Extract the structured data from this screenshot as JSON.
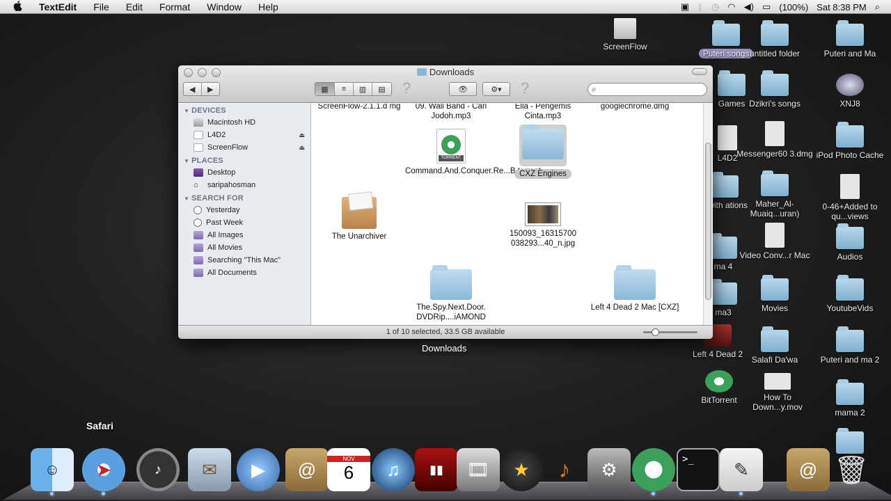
{
  "menubar": {
    "apple": "",
    "app": "TextEdit",
    "items": [
      "File",
      "Edit",
      "Format",
      "Window",
      "Help"
    ],
    "battery": "(100%)",
    "clock": "Sat 8:38 PM"
  },
  "desktop": {
    "icons": [
      {
        "label": "ScreenFlow"
      },
      {
        "label": "Puteri songs"
      },
      {
        "label": "untitled folder"
      },
      {
        "label": "Puteri and Ma"
      },
      {
        "label": "Games"
      },
      {
        "label": "Dzikri's songs"
      },
      {
        "label": "XNJ8"
      },
      {
        "label": "L4D2"
      },
      {
        "label": "Messenger60 3.dmg"
      },
      {
        "label": "iPod Photo Cache"
      },
      {
        "label": "s with ations"
      },
      {
        "label": "Maher_Al-Muaiq...uran)"
      },
      {
        "label": "0-46+Added to qu...views"
      },
      {
        "label": "ma 4"
      },
      {
        "label": "Video Conv...r Mac"
      },
      {
        "label": "Audios"
      },
      {
        "label": "ma3"
      },
      {
        "label": "Movies"
      },
      {
        "label": "YoutubeVids"
      },
      {
        "label": "Left 4 Dead 2"
      },
      {
        "label": "Salafi Da'wa"
      },
      {
        "label": "Puteri and ma 2"
      },
      {
        "label": "BitTorrent"
      },
      {
        "label": "How To Down...y.mov"
      },
      {
        "label": "mama 2"
      }
    ]
  },
  "window": {
    "title": "Downloads",
    "search_placeholder": "",
    "status": "1 of 10 selected, 33.5 GB available",
    "toolbar": {
      "back": "◀",
      "forward": "▶",
      "view_icon": "▦",
      "view_list": "≡",
      "view_column": "▥",
      "view_coverflow": "▤",
      "quicklook": "👁",
      "action": "⚙▾",
      "help": "?"
    },
    "sidebar": {
      "devices_header": "DEVICES",
      "devices": [
        {
          "label": "Macintosh HD",
          "eject": false
        },
        {
          "label": "L4D2",
          "eject": true
        },
        {
          "label": "ScreenFlow",
          "eject": true
        }
      ],
      "places_header": "PLACES",
      "places": [
        {
          "label": "Desktop"
        },
        {
          "label": "saripahosman"
        }
      ],
      "search_header": "SEARCH FOR",
      "searches": [
        {
          "label": "Yesterday"
        },
        {
          "label": "Past Week"
        },
        {
          "label": "All Images"
        },
        {
          "label": "All Movies"
        },
        {
          "label": "Searching \"This Mac\""
        },
        {
          "label": "All Documents"
        }
      ]
    },
    "items": [
      {
        "label": "ScreenFlow-2.1.1.d mg"
      },
      {
        "label": "09. Wali Band - Cari Jodoh.mp3"
      },
      {
        "label": "Ella - Pengemis Cinta.mp3"
      },
      {
        "label": "googlechrome.dmg"
      },
      {
        "label": "Command.And.Conquer.Re...B.torrent"
      },
      {
        "label": "CXZ Engines"
      },
      {
        "label": "The Unarchiver"
      },
      {
        "label": "150093_16315700 038293...40_n.jpg"
      },
      {
        "label": "The.Spy.Next.Door. DVDRip....iAMOND"
      },
      {
        "label": "Left 4 Dead 2 Mac [CXZ]"
      }
    ]
  },
  "tooltip": "Downloads",
  "dock": {
    "hover_label": "Safari",
    "apps": [
      {
        "name": "Finder"
      },
      {
        "name": "Safari"
      },
      {
        "name": "Dashboard"
      },
      {
        "name": "Mail"
      },
      {
        "name": "iChat"
      },
      {
        "name": "Address Book"
      },
      {
        "name": "iCal",
        "day": "6",
        "month": "NOV"
      },
      {
        "name": "iTunes"
      },
      {
        "name": "Front Row"
      },
      {
        "name": "iPhoto"
      },
      {
        "name": "iMovie"
      },
      {
        "name": "iMovie Star"
      },
      {
        "name": "GarageBand"
      },
      {
        "name": "System Preferences"
      },
      {
        "name": "BitTorrent"
      },
      {
        "name": "Terminal"
      },
      {
        "name": "TextEdit"
      },
      {
        "name": "Address Book 2"
      },
      {
        "name": "Trash"
      }
    ]
  }
}
